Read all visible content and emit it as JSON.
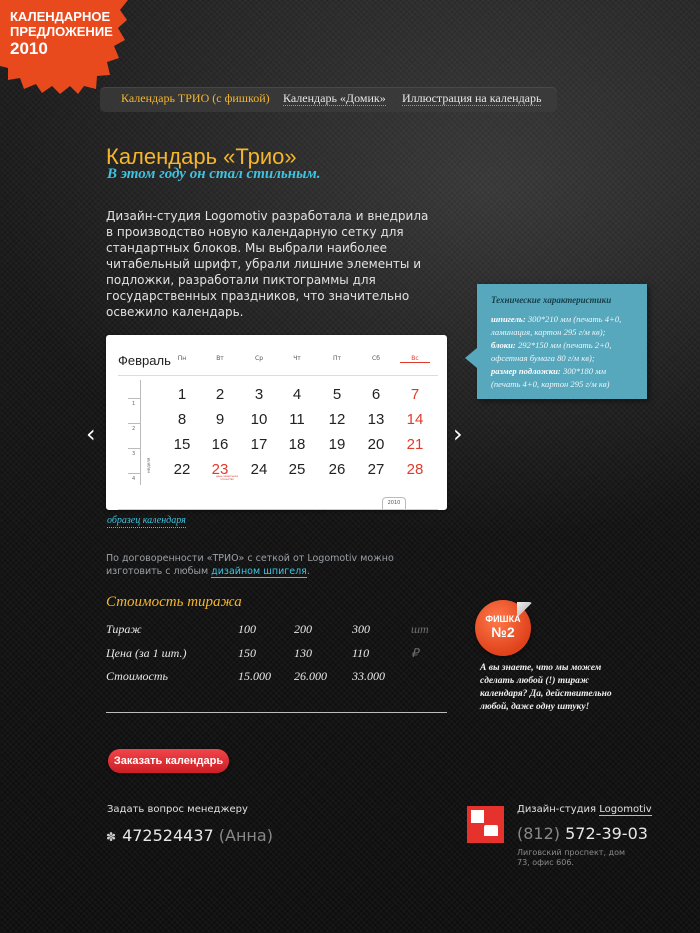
{
  "badge": {
    "line1": "КАЛЕНДАРНОЕ",
    "line2": "ПРЕДЛОЖЕНИЕ",
    "year": "2010"
  },
  "nav": [
    {
      "label": "Календарь ТРИО (с фишкой)",
      "active": true
    },
    {
      "label": "Календарь «Домик»",
      "active": false
    },
    {
      "label": "Иллюстрация на календарь",
      "active": false
    }
  ],
  "title": "Календарь «Трио»",
  "subtitle": "В этом году он стал стильным.",
  "description": "Дизайн-студия Logomotiv разработала и внедрила в производство новую календарную сетку для стандартных блоков. Мы выбрали наиболее читабельный шрифт, убрали лишние элементы и подложки, разработали пиктограммы для государственных праздников, что значительно освежило календарь.",
  "spec": {
    "title": "Технические характеристики",
    "items": [
      {
        "label": "шпигель:",
        "value": "300*210 мм (печать 4+0, ламинация, картон 295 г/м кв);"
      },
      {
        "label": "блоки:",
        "value": "292*150 мм (печать 2+0, офсетная бумага 80 г/м кв);"
      },
      {
        "label": "размер подложки:",
        "value": "300*180 мм (печать 4+0, картон 295 г/м кв)"
      }
    ]
  },
  "calendar": {
    "month": "Февраль",
    "weekdays": [
      "Пн",
      "Вт",
      "Ср",
      "Чт",
      "Пт",
      "Сб",
      "Вс"
    ],
    "weeks": [
      [
        "1",
        "2",
        "3",
        "4",
        "5",
        "6",
        "7"
      ],
      [
        "8",
        "9",
        "10",
        "11",
        "12",
        "13",
        "14"
      ],
      [
        "15",
        "16",
        "17",
        "18",
        "19",
        "20",
        "21"
      ],
      [
        "22",
        "23",
        "24",
        "25",
        "26",
        "27",
        "28"
      ]
    ],
    "week_numbers": [
      "1",
      "2",
      "3",
      "4"
    ],
    "week_label": "неделя",
    "holiday_day": "23",
    "holiday_note": "день защитника отечества",
    "year_tab": "2010",
    "prev_arrow": "‹",
    "next_arrow": "›"
  },
  "sample_link": "образец календаря",
  "note": {
    "text": "По договоренности «ТРИО» с сеткой от Logomotiv можно изготовить с любым ",
    "link": "дизайном шпигеля",
    "end": "."
  },
  "cost": {
    "heading": "Стоимость тиража",
    "rows": [
      {
        "label": "Тираж",
        "values": [
          "100",
          "200",
          "300"
        ],
        "unit": "шт"
      },
      {
        "label": "Цена (за 1 шт.)",
        "values": [
          "150",
          "130",
          "110"
        ],
        "unit": "₽"
      },
      {
        "label": "Стоимость",
        "values": [
          "15.000",
          "26.000",
          "33.000"
        ],
        "unit": ""
      }
    ]
  },
  "fishka": {
    "label": "ФИШКА",
    "number": "№2",
    "text": "А вы знаете, что мы можем сделать любой (!) тираж календаря? Да, действительно любой, даже одну штуку!"
  },
  "order_button": "Заказать календарь",
  "contact": {
    "ask": "Задать вопрос менеджеру",
    "icq_number": "472524437",
    "icq_name": "(Анна)",
    "studio_prefix": "Дизайн-студия ",
    "studio_link": "Logomotiv",
    "phone_code": "(812)",
    "phone": "572-39-03",
    "address": "Лиговский проспект, дом 73, офис 606."
  },
  "colors": {
    "accent": "#f5b62c",
    "link": "#3ec3e0",
    "badge": "#e84a1e",
    "button": "#e0292f",
    "spec_bg": "#58a8bd"
  }
}
